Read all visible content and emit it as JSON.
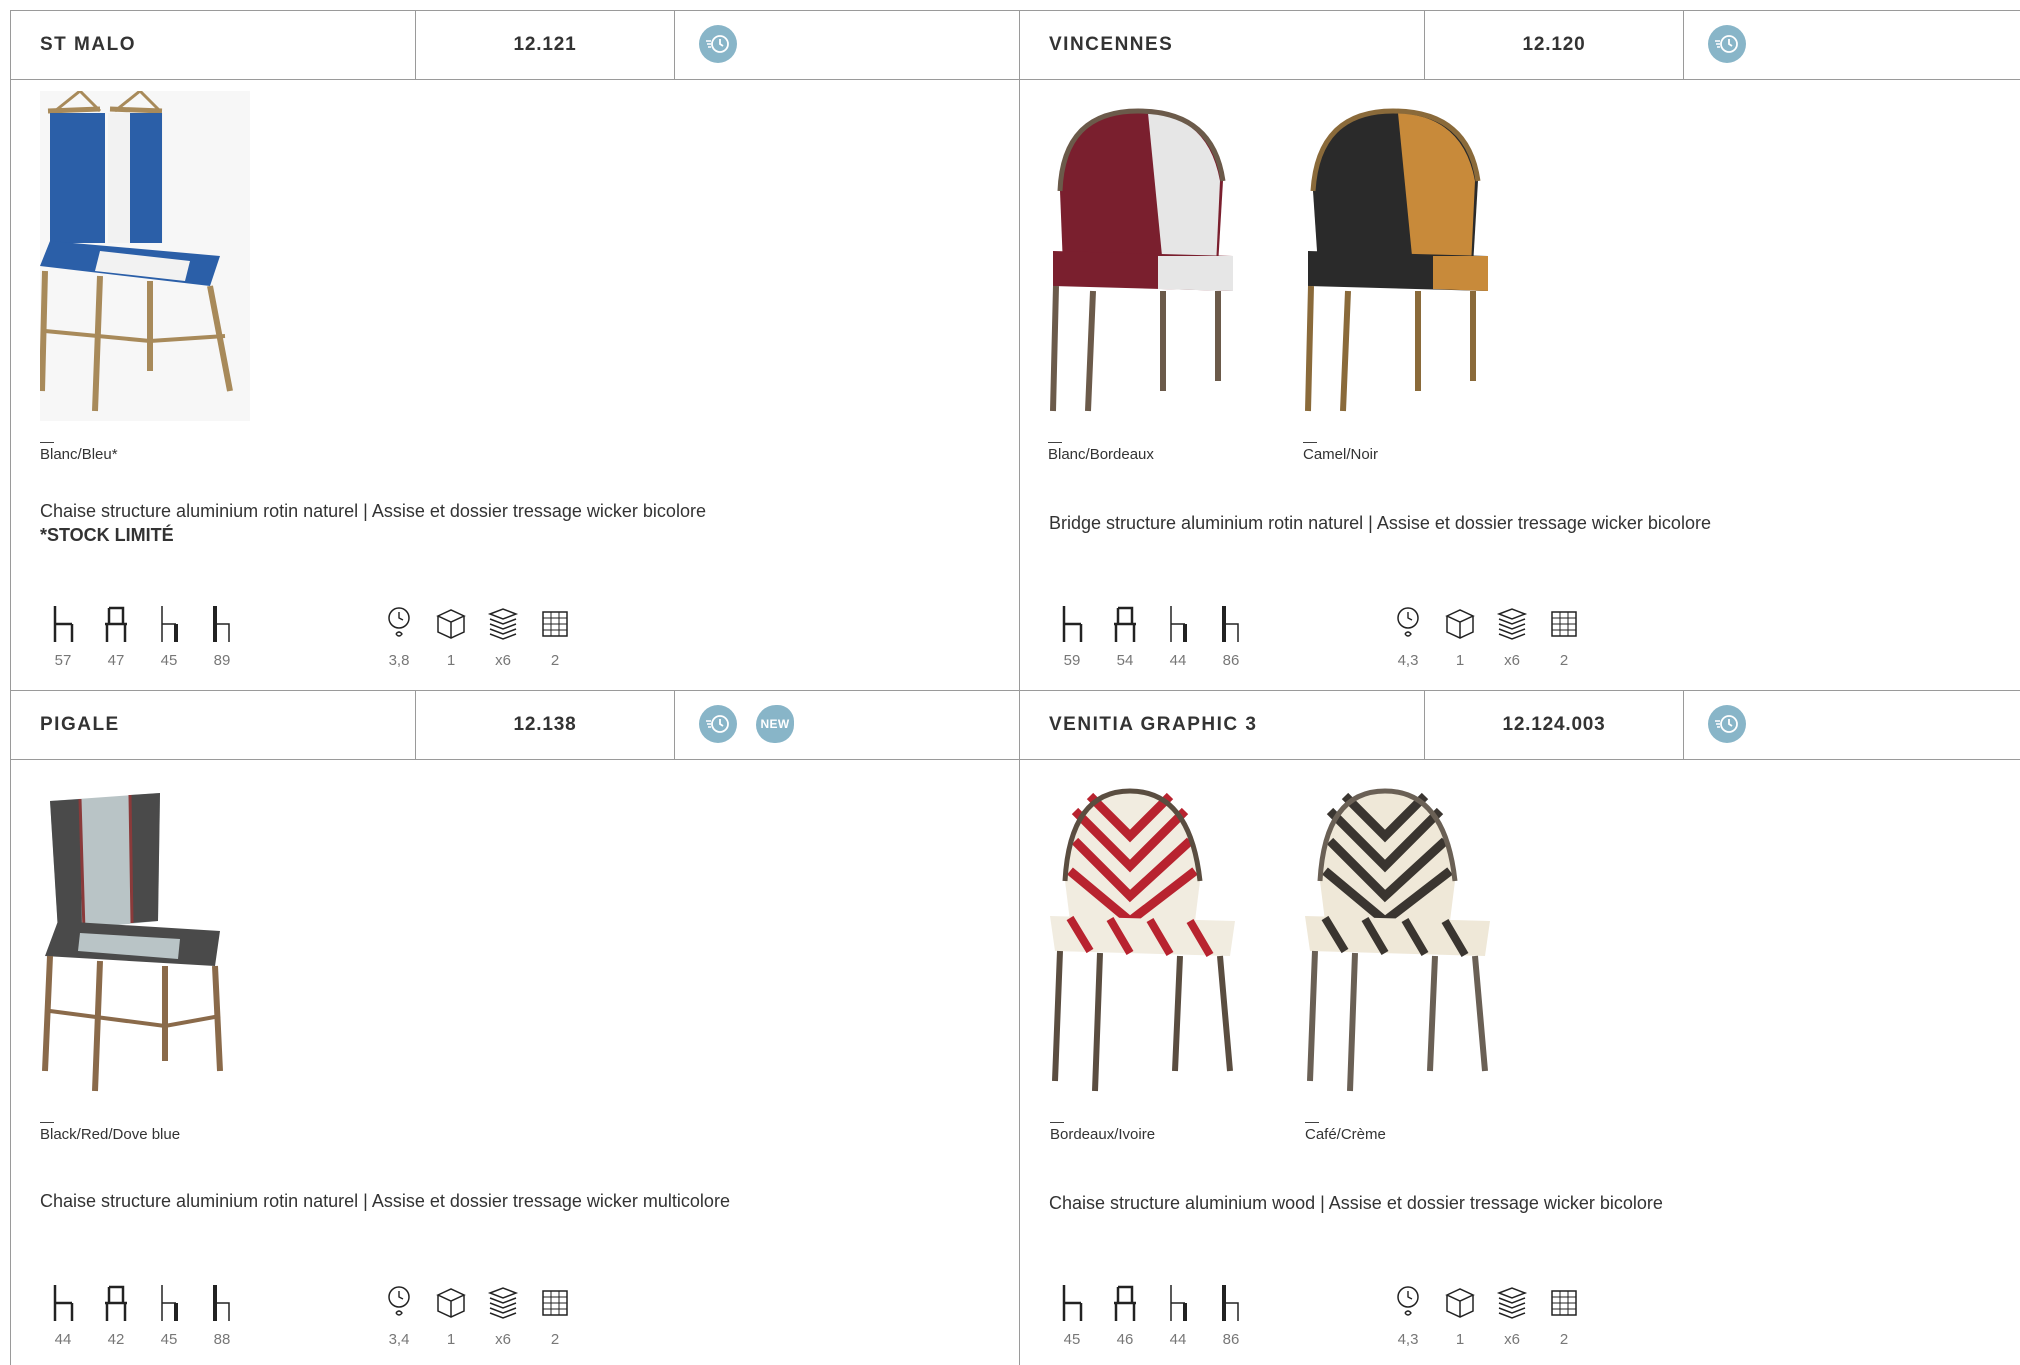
{
  "cards": [
    {
      "name": "ST MALO",
      "ref": "12.121",
      "badges": {
        "express": true,
        "new": false,
        "new_label": ""
      },
      "variants": [
        {
          "label": "Blanc/Bleu*",
          "dash": "—"
        }
      ],
      "description": "Chaise structure aluminium rotin naturel | Assise et dossier tressage wicker bicolore",
      "note": "*STOCK LIMITÉ",
      "dims": [
        "57",
        "47",
        "45",
        "89"
      ],
      "logistics": [
        "3,8",
        "1",
        "x6",
        "2"
      ]
    },
    {
      "name": "VINCENNES",
      "ref": "12.120",
      "badges": {
        "express": true,
        "new": false,
        "new_label": ""
      },
      "variants": [
        {
          "label": "Blanc/Bordeaux",
          "dash": "—"
        },
        {
          "label": "Camel/Noir",
          "dash": "—"
        }
      ],
      "description": "Bridge structure aluminium rotin naturel | Assise et dossier tressage wicker bicolore",
      "note": "",
      "dims": [
        "59",
        "54",
        "44",
        "86"
      ],
      "logistics": [
        "4,3",
        "1",
        "x6",
        "2"
      ]
    },
    {
      "name": "PIGALE",
      "ref": "12.138",
      "badges": {
        "express": true,
        "new": true,
        "new_label": "NEW"
      },
      "variants": [
        {
          "label": "Black/Red/Dove blue",
          "dash": "—"
        }
      ],
      "description": "Chaise structure aluminium rotin naturel | Assise et dossier tressage wicker multicolore",
      "note": "",
      "dims": [
        "44",
        "42",
        "45",
        "88"
      ],
      "logistics": [
        "3,4",
        "1",
        "x6",
        "2"
      ]
    },
    {
      "name": "VENITIA GRAPHIC 3",
      "ref": "12.124.003",
      "badges": {
        "express": true,
        "new": false,
        "new_label": ""
      },
      "variants": [
        {
          "label": "Bordeaux/Ivoire",
          "dash": "—"
        },
        {
          "label": "Café/Crème",
          "dash": "—"
        }
      ],
      "description": "Chaise structure aluminium wood | Assise et dossier tressage wicker bicolore",
      "note": "",
      "dims": [
        "45",
        "46",
        "44",
        "86"
      ],
      "logistics": [
        "4,3",
        "1",
        "x6",
        "2"
      ]
    }
  ],
  "colors": {
    "badge": "#88b5c8",
    "border": "#9a9a9a",
    "text": "#333333",
    "spec_value": "#777777",
    "chairs": {
      "st_malo": [
        "#2b5fa8",
        "#f2f2f2",
        "#a88a5a"
      ],
      "vincennes_1": [
        "#7a1f2e",
        "#e6e6e6",
        "#6b5a4a"
      ],
      "vincennes_2": [
        "#2a2a2a",
        "#c88a3a",
        "#8a6a3a"
      ],
      "pigale": [
        "#4a4a4a",
        "#b9c4c6",
        "#8a3a3a"
      ],
      "venitia_1": [
        "#b8232f",
        "#f1ece0",
        "#5a4d40"
      ],
      "venitia_2": [
        "#3a3530",
        "#efe8d8",
        "#6a6055"
      ]
    }
  },
  "icons": {
    "dims": [
      "chair-width-icon",
      "chair-depth-icon",
      "seat-height-icon",
      "total-height-icon"
    ],
    "logistics": [
      "weight-icon",
      "box-icon",
      "stack-icon",
      "pallet-icon"
    ]
  }
}
